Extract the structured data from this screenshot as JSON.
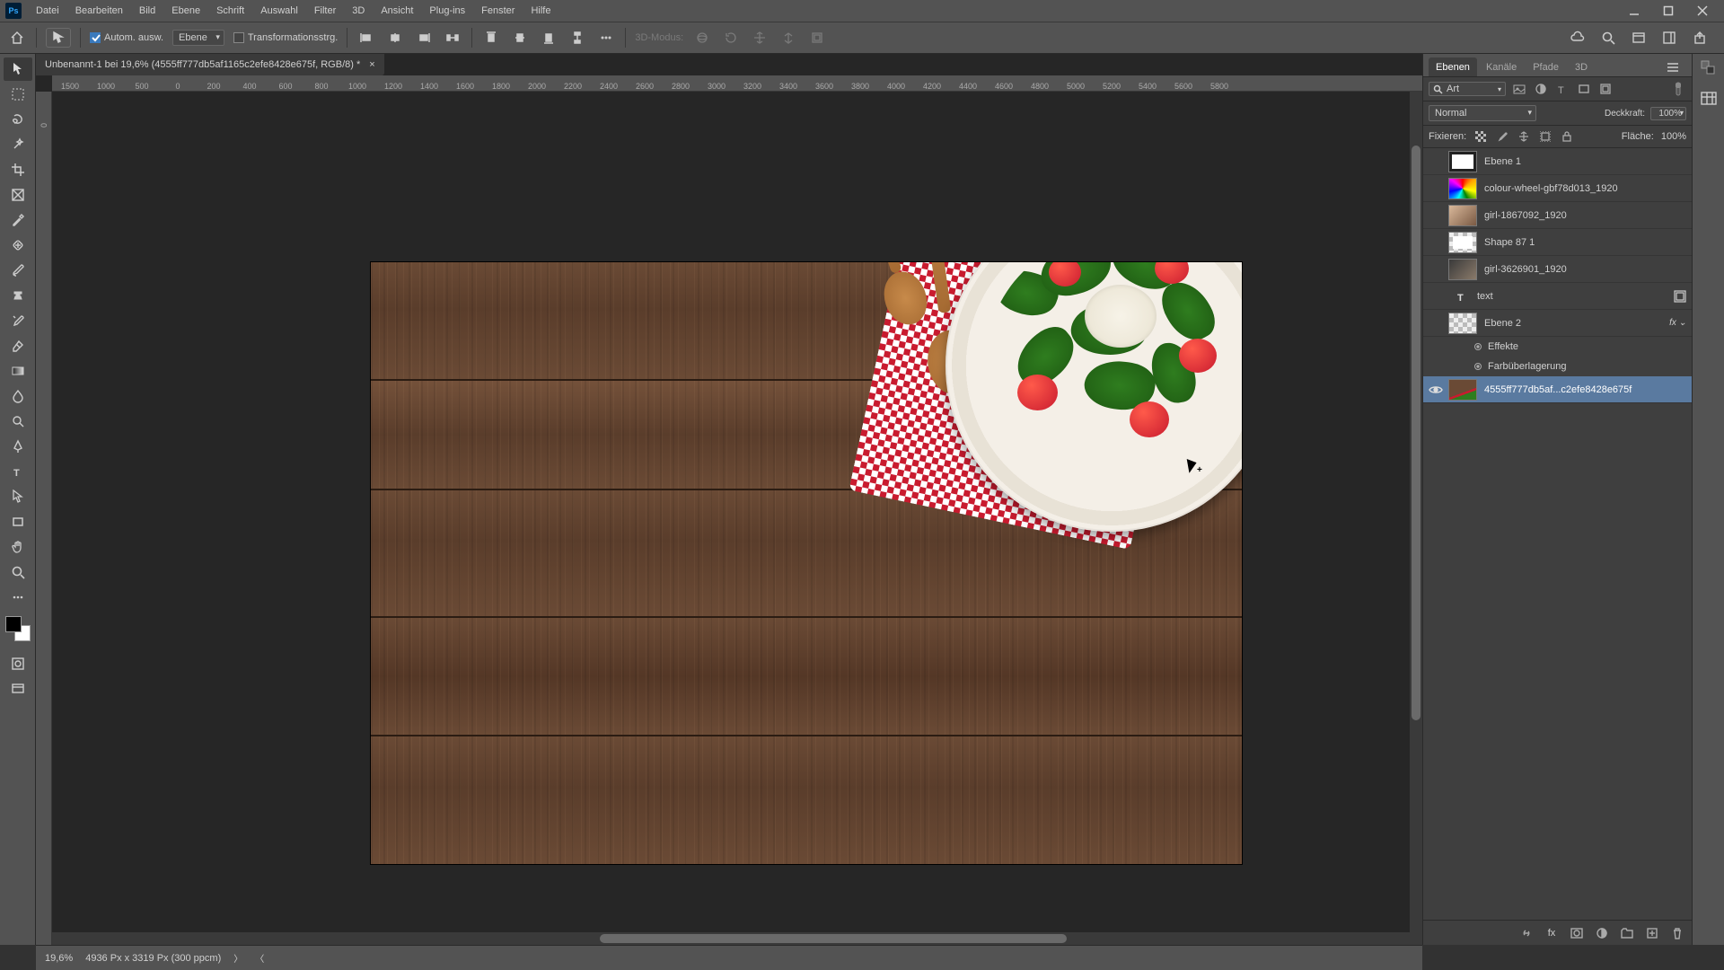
{
  "app_icon_text": "Ps",
  "menu": [
    "Datei",
    "Bearbeiten",
    "Bild",
    "Ebene",
    "Schrift",
    "Auswahl",
    "Filter",
    "3D",
    "Ansicht",
    "Plug-ins",
    "Fenster",
    "Hilfe"
  ],
  "options": {
    "auto_select_label": "Autom. ausw.",
    "target_dropdown": "Ebene",
    "transform_label": "Transformationsstrg.",
    "mode3d_label": "3D-Modus:"
  },
  "doc_tab": {
    "title": "Unbenannt-1 bei 19,6% (4555ff777db5af1165c2efe8428e675f, RGB/8) *",
    "close": "×"
  },
  "ruler_marks": [
    "1500",
    "1000",
    "500",
    "0",
    "200",
    "400",
    "600",
    "800",
    "1000",
    "1200",
    "1400",
    "1600",
    "1800",
    "2000",
    "2200",
    "2400",
    "2600",
    "2800",
    "3000",
    "3200",
    "3400",
    "3600",
    "3800",
    "4000",
    "4200",
    "4400",
    "4600",
    "4800",
    "5000",
    "5200",
    "5400",
    "5600",
    "5800"
  ],
  "ruler_v": [
    "0",
    "",
    "",
    "0"
  ],
  "panels": {
    "tabs": [
      "Ebenen",
      "Kanäle",
      "Pfade",
      "3D"
    ],
    "search_placeholder": "Art",
    "blend_mode": "Normal",
    "opacity_label": "Deckkraft:",
    "opacity_value": "100%",
    "lock_label": "Fixieren:",
    "fill_label": "Fläche:",
    "fill_value": "100%"
  },
  "layers": [
    {
      "name": "Ebene 1",
      "thumb": "white",
      "visible": false
    },
    {
      "name": "colour-wheel-gbf78d013_1920",
      "thumb": "wheel",
      "visible": false
    },
    {
      "name": "girl-1867092_1920",
      "thumb": "img",
      "visible": false
    },
    {
      "name": "Shape 87 1",
      "thumb": "check",
      "visible": false
    },
    {
      "name": "girl-3626901_1920",
      "thumb": "img2",
      "visible": false
    },
    {
      "name": "text",
      "thumb": "T",
      "visible": false,
      "smart": true
    },
    {
      "name": "Ebene 2",
      "thumb": "check",
      "visible": false,
      "fx": true
    },
    {
      "name": "4555ff777db5af...c2efe8428e675f",
      "thumb": "food",
      "visible": true,
      "selected": true
    }
  ],
  "effects": {
    "title": "Effekte",
    "item": "Farbüberlagerung"
  },
  "status": {
    "zoom": "19,6%",
    "dims": "4936 Px x 3319 Px (300 ppcm)"
  }
}
